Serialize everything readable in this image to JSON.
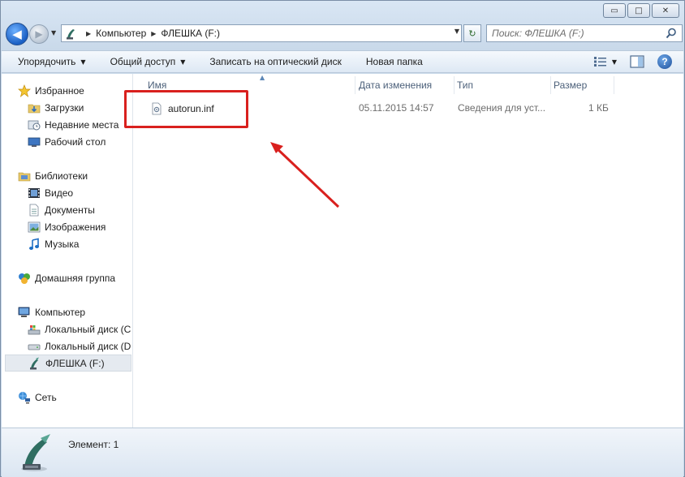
{
  "window": {
    "caption_buttons": {
      "minimize": "▭",
      "maximize": "□",
      "close": "✕"
    }
  },
  "address_bar": {
    "back_glyph": "◀",
    "forward_glyph": "▶",
    "history_glyph": "▼",
    "crumbs": [
      "Компьютер",
      "ФЛЕШКА (F:)"
    ],
    "separator": "▶",
    "dropdown_glyph": "▼",
    "refresh_glyph": "↻",
    "search_placeholder": "Поиск: ФЛЕШКА (F:)"
  },
  "toolbar": {
    "organize": "Упорядочить",
    "share": "Общий доступ",
    "burn": "Записать на оптический диск",
    "new_folder": "Новая папка",
    "dropdown_glyph": "▼",
    "help_glyph": "?"
  },
  "nav": {
    "favorites": "Избранное",
    "downloads": "Загрузки",
    "recent": "Недавние места",
    "desktop": "Рабочий стол",
    "libraries": "Библиотеки",
    "video": "Видео",
    "documents": "Документы",
    "pictures": "Изображения",
    "music": "Музыка",
    "homegroup": "Домашняя группа",
    "computer": "Компьютер",
    "disk_c": "Локальный диск (C",
    "disk_d": "Локальный диск (D",
    "flash": "ФЛЕШКА (F:)",
    "network": "Сеть"
  },
  "columns": {
    "name": "Имя",
    "date": "Дата изменения",
    "type": "Тип",
    "size": "Размер",
    "sort_glyph": "▲"
  },
  "files": [
    {
      "name": "autorun.inf",
      "date": "05.11.2015 14:57",
      "type": "Сведения для уст...",
      "size": "1 КБ"
    }
  ],
  "status": {
    "text": "Элемент: 1"
  },
  "colors": {
    "annotation_red": "#d9201e",
    "selection": "#e5eaf0"
  }
}
